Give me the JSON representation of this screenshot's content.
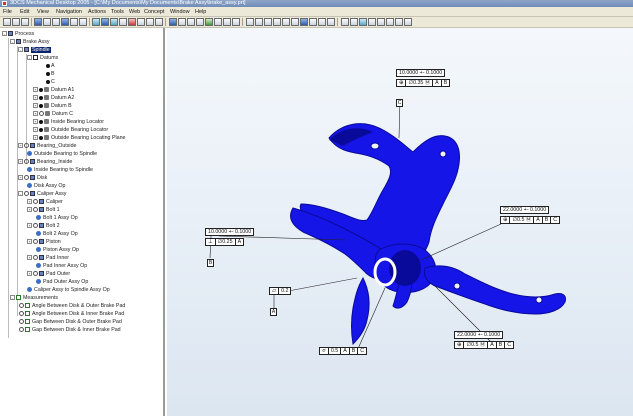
{
  "window": {
    "title": "3DCS Mechanical Desktop 2005 - [C:\\My Documents\\My Documents\\Brake Assy\\brake_assy.prt]"
  },
  "menubar": {
    "items": [
      "File",
      "Edit",
      "View",
      "Navigation",
      "Actions",
      "Tools",
      "Web",
      "Concept",
      "Window",
      "Help"
    ]
  },
  "tree": {
    "rows": [
      {
        "label": "Process"
      },
      {
        "label": "Brake Assy"
      },
      {
        "label": "Spindle"
      },
      {
        "label": "Datums"
      },
      {
        "label": "A"
      },
      {
        "label": "B"
      },
      {
        "label": "C"
      },
      {
        "label": "Datum A1"
      },
      {
        "label": "Datum A2"
      },
      {
        "label": "Datum B"
      },
      {
        "label": "Datum C"
      },
      {
        "label": "Inside Bearing Locator"
      },
      {
        "label": "Outside Bearing Locator"
      },
      {
        "label": "Outside Bearing Locating Plane"
      },
      {
        "label": "Bearing_Outside"
      },
      {
        "label": "Outside Bearing to Spindle"
      },
      {
        "label": "Bearing_Inside"
      },
      {
        "label": "Inside Bearing to Spindle"
      },
      {
        "label": "Disk"
      },
      {
        "label": "Disk Assy Op"
      },
      {
        "label": "Caliper Assy"
      },
      {
        "label": "Caliper"
      },
      {
        "label": "Bolt 1"
      },
      {
        "label": "Bolt 1 Assy Op"
      },
      {
        "label": "Bolt 2"
      },
      {
        "label": "Bolt 2 Assy Op"
      },
      {
        "label": "Piston"
      },
      {
        "label": "Piston Assy Op"
      },
      {
        "label": "Pad Inner"
      },
      {
        "label": "Pad Inner Assy Op"
      },
      {
        "label": "Pad Outer"
      },
      {
        "label": "Pad Outer Assy Op"
      },
      {
        "label": "Caliper Assy to Spindle Assy Op"
      },
      {
        "label": "Measurements"
      },
      {
        "label": "Angle Between Disk & Outer Brake Pad"
      },
      {
        "label": "Angle Between Disk & Inner Brake Pad"
      },
      {
        "label": "Gap Between Disk & Outer Brake Pad"
      },
      {
        "label": "Gap Between Disk & Inner Brake Pad"
      }
    ]
  },
  "annotations": {
    "top": {
      "tol": "10.0000 +-  0.1000",
      "cells": [
        "⊕",
        "∅0.35 Ⓜ",
        "A",
        "B"
      ],
      "tag": "C"
    },
    "left": {
      "tol": "10.0000 +-  0.1000",
      "cells": [
        "⊥",
        "∅0.25",
        "A"
      ],
      "tag": "B"
    },
    "flat": {
      "cells": [
        "⏥",
        "0.2"
      ],
      "tag": "A"
    },
    "right_mid": {
      "tol": "22.0000 +-  0.1000",
      "cells": [
        "⊕",
        "∅0.5 Ⓜ",
        "A",
        "B",
        "C"
      ]
    },
    "bottom_right": {
      "tol": "22.0000 +-  0.1000",
      "cells": [
        "⊕",
        "∅0.5 Ⓜ",
        "A",
        "B",
        "C"
      ]
    },
    "bottom": {
      "cells": [
        "⌭",
        "0.5",
        "A",
        "B",
        "C"
      ]
    }
  },
  "colors": {
    "part": "#1515e8",
    "part_shadow": "#0a0a9a",
    "viewport_bg": "#e4ecf5"
  }
}
